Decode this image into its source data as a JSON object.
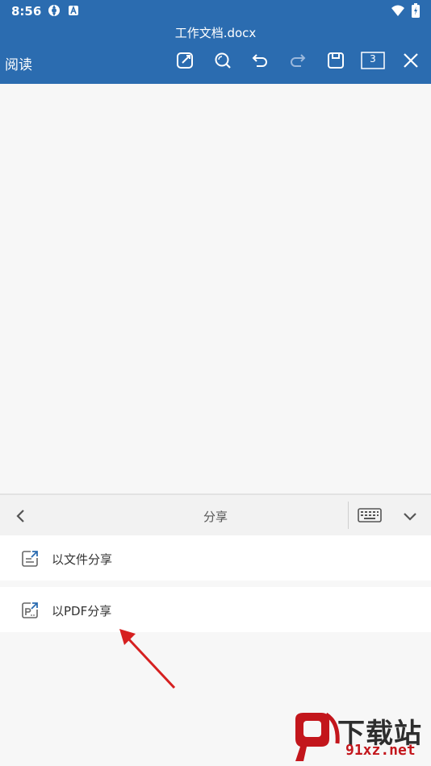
{
  "status": {
    "time": "8:56"
  },
  "header": {
    "doc_title": "工作文档.docx",
    "mode_label": "阅读",
    "page_count": "3"
  },
  "toolbar": {
    "icons": [
      "edit-icon",
      "search-icon",
      "undo-icon",
      "redo-icon",
      "save-icon",
      "page-count-icon",
      "close-icon"
    ]
  },
  "panel": {
    "title": "分享",
    "items": [
      {
        "label": "以文件分享",
        "icon": "file-share-icon"
      },
      {
        "label": "以PDF分享",
        "icon": "pdf-share-icon"
      }
    ]
  },
  "watermark": {
    "brand": "下载站",
    "url": "91xz.net",
    "logo_text": "9"
  },
  "colors": {
    "header_bg": "#2b6cb0",
    "accent_arrow": "#d62020",
    "watermark_red": "#c3161c"
  }
}
